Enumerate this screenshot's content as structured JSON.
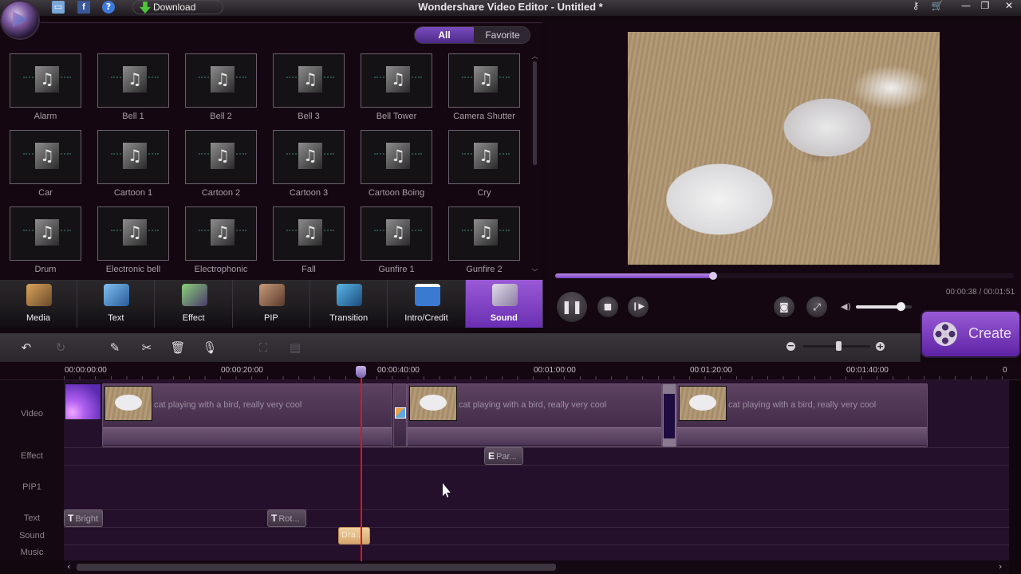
{
  "window": {
    "title": "Wondershare Video Editor - Untitled *",
    "toolbar": {
      "save_icon": "save-icon",
      "facebook_icon": "facebook-icon",
      "help_icon": "help-icon",
      "download_label": "Download"
    },
    "right_icons": [
      "key-icon",
      "cart-icon"
    ],
    "controls": {
      "minimize": "—",
      "restore": "❐",
      "close": "✕"
    }
  },
  "library": {
    "filter_tabs": [
      {
        "label": "All",
        "active": true
      },
      {
        "label": "Favorite",
        "active": false
      }
    ],
    "items": [
      "Alarm",
      "Bell 1",
      "Bell 2",
      "Bell 3",
      "Bell Tower",
      "Camera Shutter",
      "Car",
      "Cartoon 1",
      "Cartoon 2",
      "Cartoon 3",
      "Cartoon Boing",
      "Cry",
      "Drum",
      "Electronic bell",
      "Electrophonic",
      "Fall",
      "Gunfire 1",
      "Gunfire 2"
    ]
  },
  "categories": [
    {
      "label": "Media",
      "icon": "media-icon",
      "active": false
    },
    {
      "label": "Text",
      "icon": "text-icon",
      "active": false
    },
    {
      "label": "Effect",
      "icon": "effect-icon",
      "active": false
    },
    {
      "label": "PIP",
      "icon": "pip-icon",
      "active": false
    },
    {
      "label": "Transition",
      "icon": "transition-icon",
      "active": false
    },
    {
      "label": "Intro/Credit",
      "icon": "intro-credit-icon",
      "active": false
    },
    {
      "label": "Sound",
      "icon": "sound-icon",
      "active": true
    }
  ],
  "preview": {
    "timecode": "00:00:38 / 00:01:51",
    "progress_fraction": 0.345,
    "volume_fraction": 0.8,
    "controls": {
      "pause": "❚❚",
      "stop": "■",
      "next_frame": "❙▶",
      "snapshot": "📷",
      "fullscreen": "⤢",
      "volume": "🔈"
    }
  },
  "create_button": {
    "label": "Create"
  },
  "timeline_toolbar": {
    "tools": [
      {
        "name": "undo",
        "glyph": "↶",
        "enabled": true
      },
      {
        "name": "redo",
        "glyph": "↻",
        "enabled": false
      },
      {
        "name": "edit",
        "glyph": "✎",
        "enabled": true
      },
      {
        "name": "split",
        "glyph": "✂",
        "enabled": true
      },
      {
        "name": "delete",
        "glyph": "🗑",
        "enabled": true
      },
      {
        "name": "record-voiceover",
        "glyph": "🎙",
        "enabled": true
      },
      {
        "name": "crop",
        "glyph": "⛶",
        "enabled": false
      },
      {
        "name": "detect-scene",
        "glyph": "▤",
        "enabled": false
      }
    ],
    "zoom_out": "−",
    "zoom_in": "+",
    "zoom_fraction": 0.52
  },
  "ruler": {
    "ticks": [
      "00:00:00:00",
      "00:00:20:00",
      "00:00:40:00",
      "00:01:00:00",
      "00:01:20:00",
      "00:01:40:00",
      "0"
    ],
    "playhead_time": "00:00:38"
  },
  "tracks": {
    "labels": [
      "Video",
      "Effect",
      "PIP1",
      "Text",
      "Sound",
      "Music"
    ],
    "video_clips": [
      {
        "title": "cat playing with a bird, really very cool"
      },
      {
        "title": "cat playing with a bird, really very cool"
      },
      {
        "title": "cat playing with a bird, really very cool"
      }
    ],
    "effect_items": [
      {
        "badge": "E",
        "label": "Par..."
      }
    ],
    "text_items": [
      {
        "badge": "T",
        "label": "Bright"
      },
      {
        "badge": "T",
        "label": "Rot..."
      }
    ],
    "sound_items": [
      {
        "label": "Dra..."
      }
    ]
  },
  "scroll": {
    "left": "‹",
    "right": "›",
    "up": "︿",
    "down": "﹀"
  }
}
